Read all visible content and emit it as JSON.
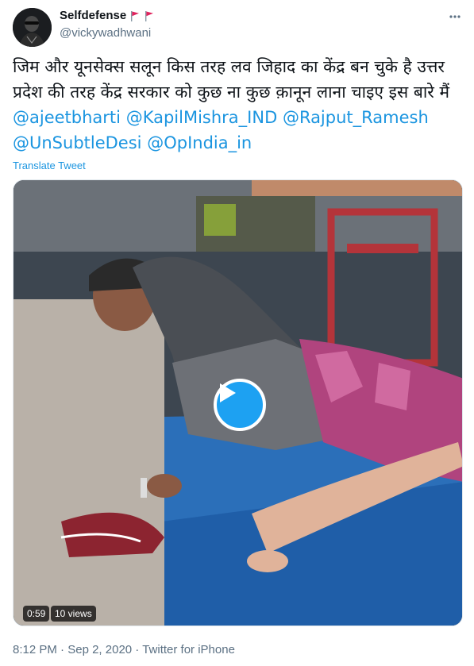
{
  "author": {
    "display_name": "Selfdefense",
    "handle": "@vickywadhwani"
  },
  "tweet": {
    "text_plain": "जिम और यूनसेक्स सलून किस तरह लव जिहाद का केंद्र बन चुके है उत्तर प्रदेश की तरह केंद्र सरकार को कुछ ना कुछ क़ानून लाना चाइए इस बारे मैं",
    "mentions": [
      "@ajeetbharti",
      "@KapilMishra_IND",
      "@Rajput_Ramesh",
      "@UnSubtleDesi",
      "@OpIndia_in"
    ],
    "translate_label": "Translate Tweet"
  },
  "video": {
    "duration": "0:59",
    "views": "10 views",
    "play_icon": "play-icon"
  },
  "meta": {
    "time": "8:12 PM",
    "date": "Sep 2, 2020",
    "source": "Twitter for iPhone",
    "separator": "·"
  },
  "colors": {
    "link": "#1b95e0",
    "secondary": "#5b7083",
    "play": "#1da1f2",
    "flag": "#e0245e"
  }
}
